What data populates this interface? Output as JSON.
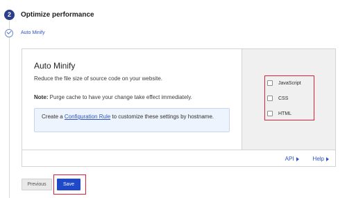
{
  "step": {
    "number": "2",
    "title": "Optimize performance"
  },
  "substep": {
    "label": "Auto Minify"
  },
  "card": {
    "title": "Auto Minify",
    "description": "Reduce the file size of source code on your website.",
    "note_label": "Note:",
    "note_text": " Purge cache to have your change take effect immediately.",
    "info": {
      "prefix": "Create a ",
      "link": "Configuration Rule",
      "suffix": " to customize these settings by hostname."
    },
    "options": [
      "JavaScript",
      "CSS",
      "HTML"
    ],
    "footer": {
      "api_label": "API",
      "help_label": "Help"
    }
  },
  "buttons": {
    "previous": "Previous",
    "save": "Save"
  },
  "colors": {
    "accent": "#1f49c8",
    "highlight": "#e21d34"
  }
}
